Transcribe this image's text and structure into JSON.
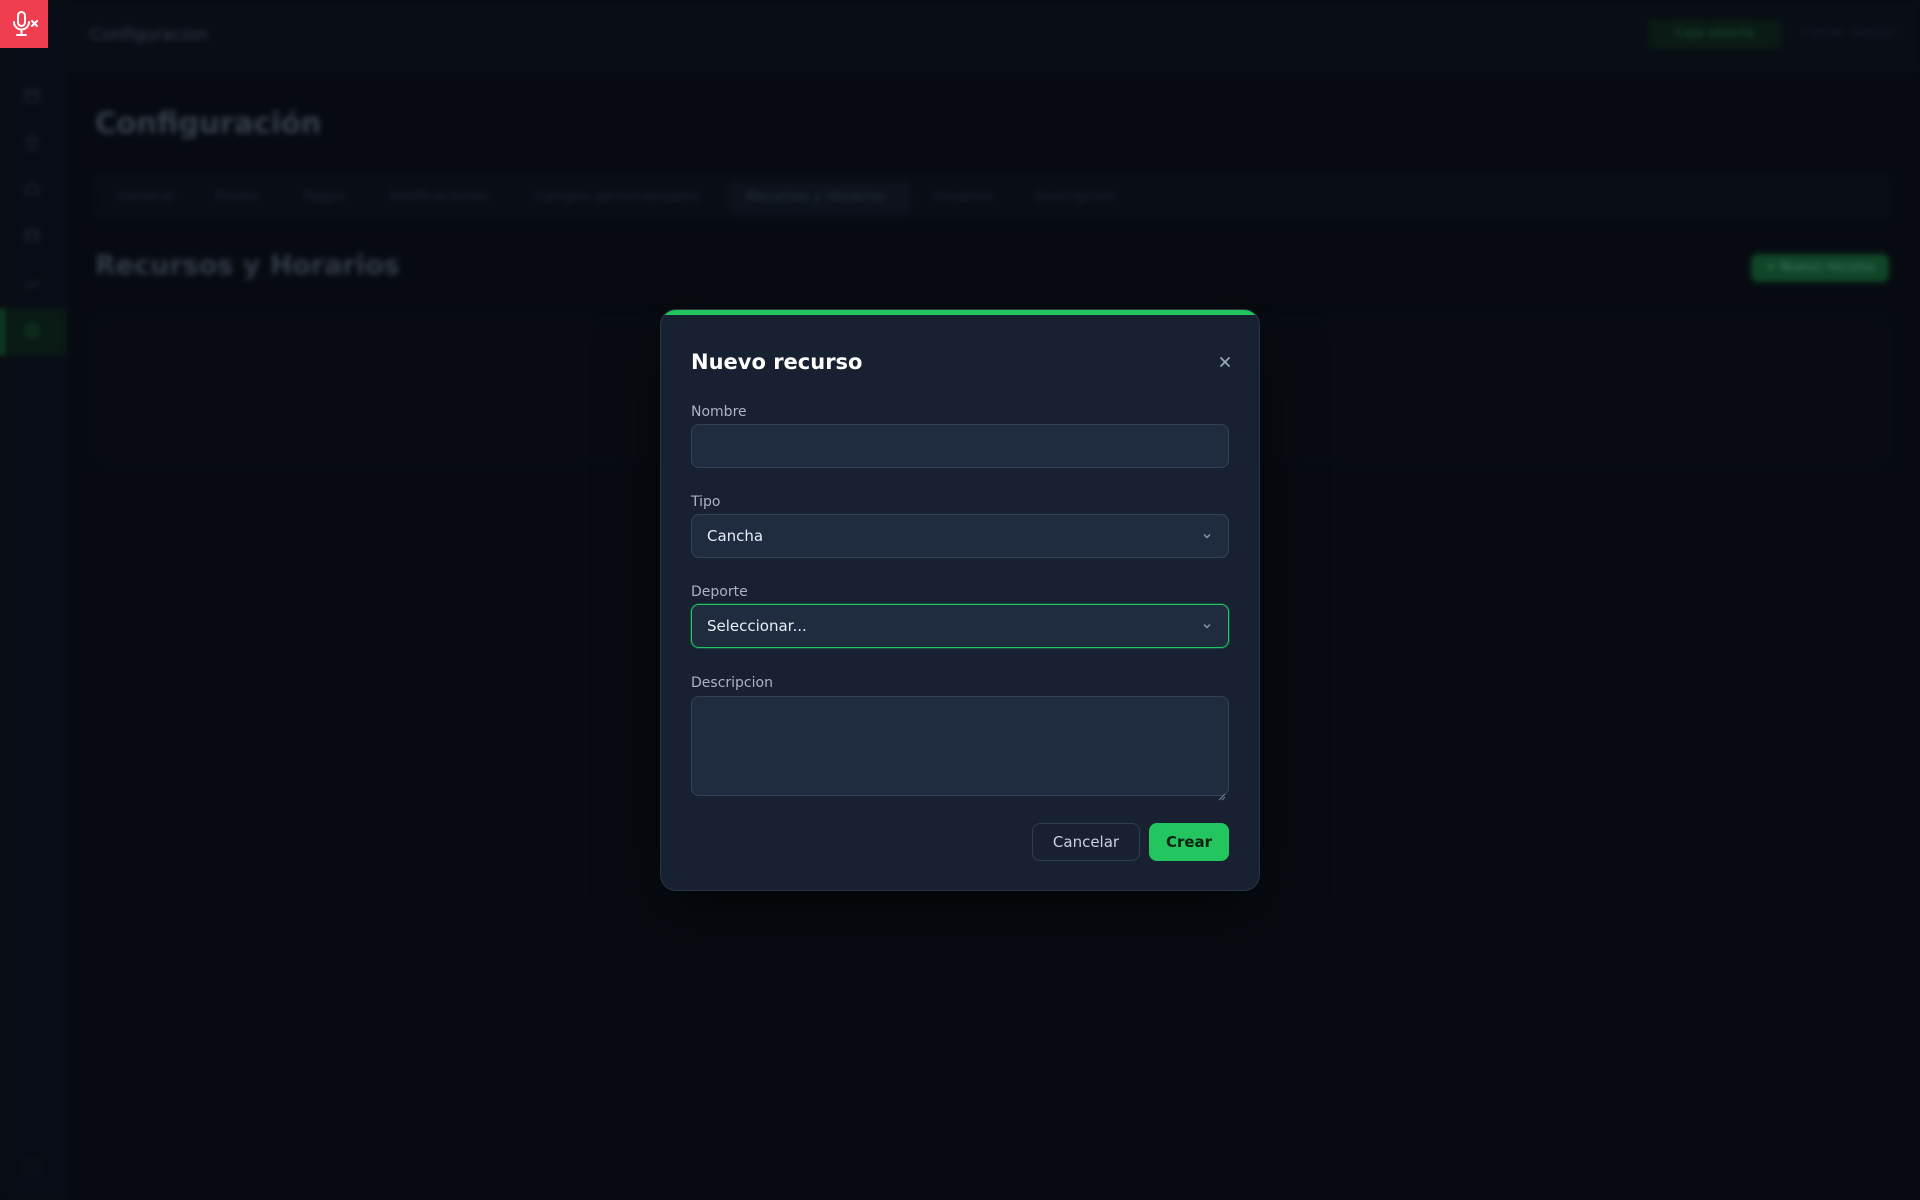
{
  "mic_badge": {
    "icon": "mic-off-icon",
    "color": "#ef3e4f"
  },
  "background": {
    "topbar": {
      "title": "Configuracion",
      "primary_button": "Caja abierta",
      "link": "Cerrar Sesión"
    },
    "page_title": "Configuración",
    "tabs": [
      {
        "label": "General",
        "active": false
      },
      {
        "label": "Predio",
        "active": false
      },
      {
        "label": "Pagos",
        "active": false
      },
      {
        "label": "Notificaciones",
        "active": false
      },
      {
        "label": "Campos personalizados",
        "active": false
      },
      {
        "label": "Recursos y Horarios",
        "active": true
      },
      {
        "label": "Usuarios",
        "active": false
      },
      {
        "label": "Suscripcion",
        "active": false
      }
    ],
    "section_title": "Recursos y Horarios",
    "section_button": "+ Nuevo recurso",
    "sidebar_icons": [
      "calendar-icon",
      "bag-icon",
      "home-icon",
      "card-icon",
      "chart-icon",
      "gear-icon",
      "help-icon"
    ]
  },
  "modal": {
    "title": "Nuevo recurso",
    "accent_color": "#22c55e",
    "fields": {
      "nombre": {
        "label": "Nombre",
        "value": "",
        "placeholder": ""
      },
      "tipo": {
        "label": "Tipo",
        "value": "Cancha"
      },
      "deporte": {
        "label": "Deporte",
        "value": "Seleccionar..."
      },
      "descripcion": {
        "label": "Descripcion",
        "value": "",
        "placeholder": ""
      }
    },
    "buttons": {
      "cancel": "Cancelar",
      "create": "Crear"
    }
  }
}
